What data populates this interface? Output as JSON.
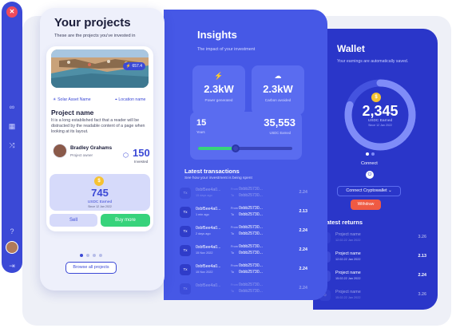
{
  "colors": {
    "primary": "#3b49d6",
    "insights_bg": "#4658e6",
    "wallet_bg": "#2a36c9",
    "success": "#37d37b",
    "danger": "#ef5a43",
    "coin": "#f5c232"
  },
  "sidebar": {
    "logo_icon": "logo-icon",
    "icons": [
      "link-icon",
      "grid-icon",
      "shuffle-icon",
      "help-icon",
      "logout-icon"
    ]
  },
  "projects": {
    "title": "Your projects",
    "subtitle": "These are the projects you've invested in",
    "image_badge": "657.4",
    "tag_left": "Solar Asset Name",
    "tag_right": "Location name",
    "name": "Project name",
    "description": "It is a long established fact that a reader will be distracted by the readable content of a page when looking at its layout.",
    "owner_name": "Bradley Grahams",
    "owner_role": "Project owner",
    "invested_count": "150",
    "invested_label": "Invested",
    "earned_value": "745",
    "earned_label": "USDC Earned",
    "earned_since": "Since 12 Jan 2022",
    "sell_label": "Sell",
    "buy_label": "Buy more",
    "browse_label": "Browse all projects"
  },
  "insights": {
    "title": "Insights",
    "subtitle": "The impact of your investment",
    "power_value": "2.3kW",
    "power_label": "Power generated",
    "carbon_value": "2.3kW",
    "carbon_label": "Carbon avoided",
    "years_value": "15",
    "years_label": "Years",
    "usdc_value": "35,553",
    "usdc_label": "USDC Earned",
    "progress": 0.4,
    "transactions_title": "Latest transactions",
    "transactions_sub": "See how your investment is being spent",
    "transactions": [
      {
        "icon": "Tx",
        "hash": "0xbf5ee4a0...",
        "time": "15 days ago",
        "from_label": "From",
        "from": "0xbb25730...",
        "to_label": "To",
        "to": "0xbb25730...",
        "amount": "2.24",
        "faded": true
      },
      {
        "icon": "Tx",
        "hash": "0xbf5ee4a0...",
        "time": "1 min ago",
        "from_label": "From",
        "from": "0xbb25730...",
        "to_label": "To",
        "to": "0xbb25730...",
        "amount": "2.13",
        "faded": false
      },
      {
        "icon": "Tx",
        "hash": "0xbf5ee4a0...",
        "time": "2 days ago",
        "from_label": "From",
        "from": "0xbb25730...",
        "to_label": "To",
        "to": "0xbb25730...",
        "amount": "2.24",
        "faded": false
      },
      {
        "icon": "Tx",
        "hash": "0xbf5ee4a0...",
        "time": "15 Nov 2022",
        "from_label": "From",
        "from": "0xbb25730...",
        "to_label": "To",
        "to": "0xbb25730...",
        "amount": "2.24",
        "faded": false
      },
      {
        "icon": "Tx",
        "hash": "0xbf5ee4a0...",
        "time": "15 Nov 2022",
        "from_label": "From",
        "from": "0xbb25730...",
        "to_label": "To",
        "to": "0xbb25730...",
        "amount": "2.24",
        "faded": false
      },
      {
        "icon": "Tx",
        "hash": "0xbf5ee4a0...",
        "time": "",
        "from_label": "From",
        "from": "0xbb25730...",
        "to_label": "To",
        "to": "0xbb25730...",
        "amount": "2.24",
        "faded": true
      }
    ]
  },
  "wallet": {
    "title": "Wallet",
    "subtitle": "Your earnings are automatically saved.",
    "balance": "2,345",
    "balance_label": "USDC Earned",
    "balance_since": "Since 12 Jan 2022",
    "ring_fraction": 0.8,
    "connect_label": "Connect",
    "connect_wallet_label": "Connect Cryptowallet ⌄",
    "withdraw_label": "Withdraw",
    "returns_title": "Latest returns",
    "returns": [
      {
        "name": "Project name",
        "date": "12.02.22 Jan 2022",
        "amount": "3.26",
        "faded": true
      },
      {
        "name": "Project name",
        "date": "12.02.22 Jan 2022",
        "amount": "2.13",
        "faded": false
      },
      {
        "name": "Project name",
        "date": "15.02.22 Jan 2022",
        "amount": "2.24",
        "faded": false
      },
      {
        "name": "Project name",
        "date": "15.02.22 Jan 2022",
        "amount": "3.26",
        "faded": true
      }
    ]
  }
}
